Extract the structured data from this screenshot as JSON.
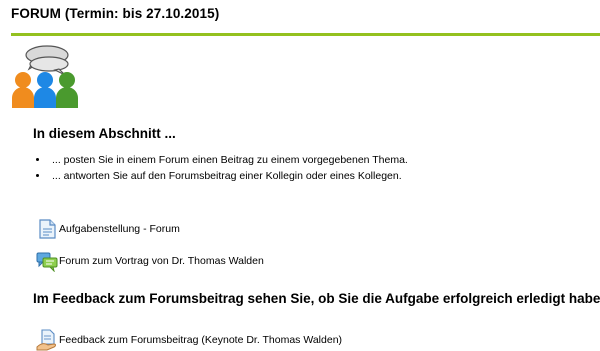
{
  "section": {
    "title": "FORUM (Termin: bis 27.10.2015)"
  },
  "colors": {
    "accent_rule": "#94c11f",
    "person_orange": "#f08c1e",
    "person_blue": "#1e88e5",
    "person_green": "#4a9a2e"
  },
  "intro": {
    "heading": "In diesem Abschnitt ...",
    "bullets": [
      "... posten Sie in einem Forum einen Beitrag zu einem vorgegebenen Thema.",
      "... antworten Sie auf den Forumsbeitrag einer Kollegin oder eines Kollegen."
    ]
  },
  "activities": [
    {
      "icon": "page-icon",
      "label": "Aufgabenstellung - Forum"
    },
    {
      "icon": "forum-icon",
      "label": "Forum zum Vortrag von Dr. Thomas Walden"
    }
  ],
  "feedback": {
    "heading": "Im Feedback zum Forumsbeitrag sehen Sie, ob Sie die Aufgabe erfolgreich erledigt haben",
    "activity": {
      "icon": "feedback-icon",
      "label": "Feedback zum Forumsbeitrag (Keynote Dr. Thomas Walden)"
    }
  }
}
